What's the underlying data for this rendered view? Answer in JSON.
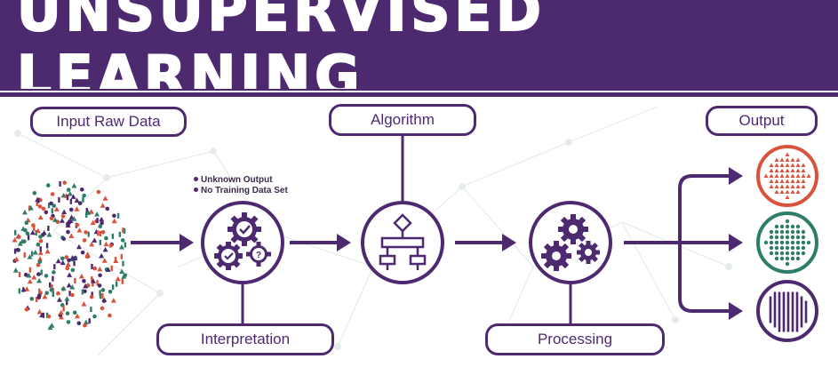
{
  "title": "UNSUPERVISED LEARNING",
  "labels": {
    "input": "Input Raw Data",
    "algorithm": "Algorithm",
    "output": "Output",
    "interpretation": "Interpretation",
    "processing": "Processing"
  },
  "notes": [
    "Unknown Output",
    "No Training Data Set"
  ],
  "colors": {
    "primary": "#4d2a70",
    "red": "#d9533c",
    "green": "#2e7d68",
    "purple": "#4d2a70",
    "background_network": "#e6ece9"
  },
  "icons": {
    "interpretation": "gears-check-question-icon",
    "algorithm": "flowchart-icon",
    "processing": "gears-icon",
    "outputs": [
      "triangles-cluster-icon",
      "dots-cluster-icon",
      "bars-cluster-icon"
    ]
  }
}
